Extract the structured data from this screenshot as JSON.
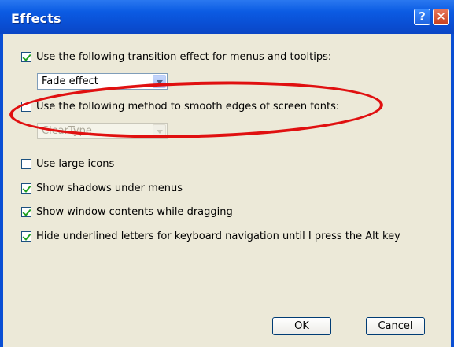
{
  "window": {
    "title": "Effects"
  },
  "titlebar_buttons": {
    "help": "?",
    "close": "✕"
  },
  "options": {
    "transition": {
      "label": "Use the following transition effect for menus and tooltips:",
      "checked": true
    },
    "transition_select": {
      "value": "Fade effect"
    },
    "smooth": {
      "label": "Use the following method to smooth edges of screen fonts:",
      "checked": false
    },
    "smooth_select": {
      "value": "ClearType",
      "disabled": true
    },
    "large_icons": {
      "label": "Use large icons",
      "checked": false
    },
    "shadows": {
      "label": "Show shadows under menus",
      "checked": true
    },
    "drag": {
      "label": "Show window contents while dragging",
      "checked": true
    },
    "underline": {
      "label": "Hide underlined letters for keyboard navigation until I press the Alt key",
      "checked": true
    }
  },
  "buttons": {
    "ok": "OK",
    "cancel": "Cancel"
  },
  "annotation": {
    "color": "#e01010"
  }
}
